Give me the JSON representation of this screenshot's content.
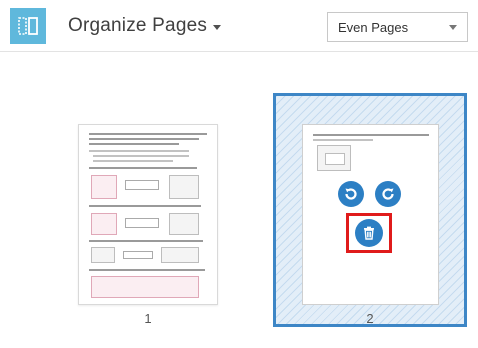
{
  "header": {
    "title": "Organize Pages",
    "tool_icon": "organize-pages-icon",
    "page_filter": {
      "selected": "Even Pages"
    }
  },
  "pages": [
    {
      "number": "1",
      "selected": false
    },
    {
      "number": "2",
      "selected": true
    }
  ],
  "page_actions": {
    "rotate_left_icon": "rotate-counterclockwise-icon",
    "rotate_right_icon": "rotate-clockwise-icon",
    "delete_icon": "trash-icon"
  },
  "colors": {
    "accent": "#2c7fc4",
    "selection_border": "#3d86c6",
    "highlight": "#e01b1b",
    "tool_icon_bg": "#5fb8dc"
  }
}
